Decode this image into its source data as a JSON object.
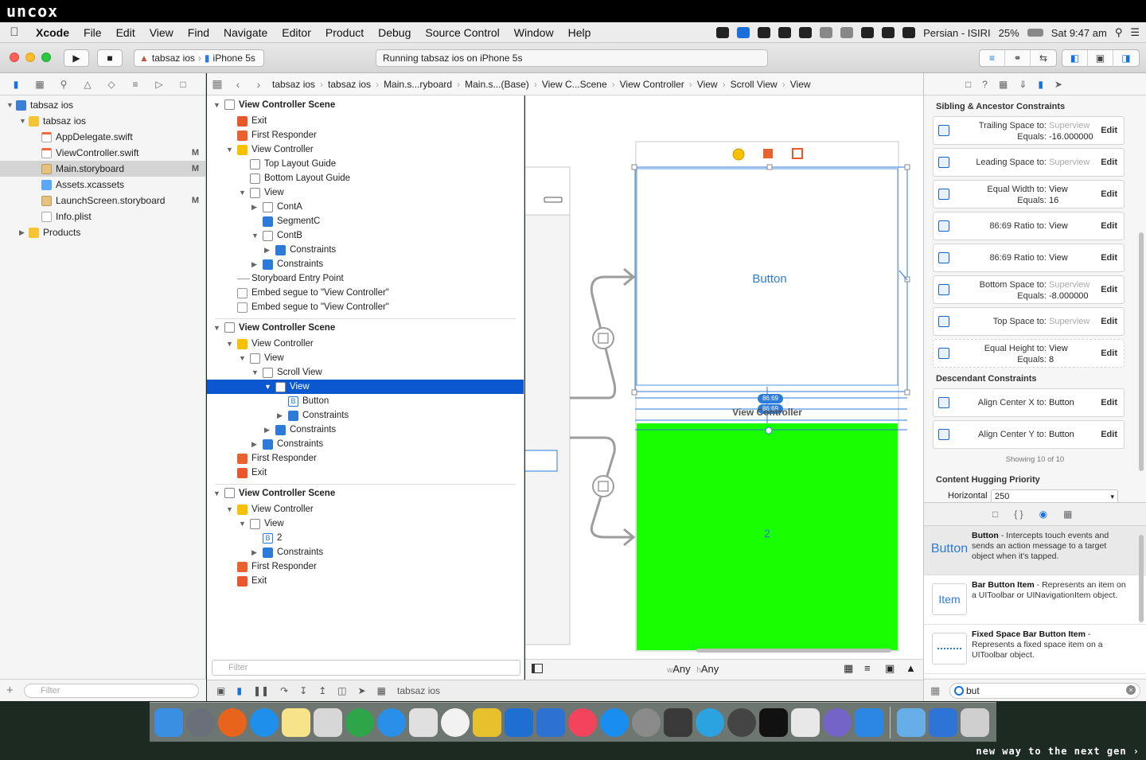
{
  "brand": {
    "logo": "uncox",
    "footer": "new way to the next gen ›"
  },
  "menubar": {
    "app": "Xcode",
    "items": [
      "File",
      "Edit",
      "View",
      "Find",
      "Navigate",
      "Editor",
      "Product",
      "Debug",
      "Source Control",
      "Window",
      "Help"
    ],
    "input_source": "Persian - ISIRI",
    "battery": "25%",
    "clock": "Sat 9:47 am"
  },
  "toolbar": {
    "scheme": "tabsaz ios",
    "device": "iPhone 5s",
    "status": "Running tabsaz ios on iPhone 5s"
  },
  "navigator": {
    "items": [
      {
        "label": "tabsaz ios",
        "level": 0,
        "icon": "project-icon",
        "disclosure": "▼",
        "badge": ""
      },
      {
        "label": "tabsaz ios",
        "level": 1,
        "icon": "folder-icon",
        "disclosure": "▼",
        "badge": ""
      },
      {
        "label": "AppDelegate.swift",
        "level": 2,
        "icon": "swift-file-icon",
        "disclosure": "",
        "badge": ""
      },
      {
        "label": "ViewController.swift",
        "level": 2,
        "icon": "swift-file-icon",
        "disclosure": "",
        "badge": "M"
      },
      {
        "label": "Main.storyboard",
        "level": 2,
        "icon": "storyboard-icon",
        "disclosure": "",
        "badge": "M",
        "selected": true
      },
      {
        "label": "Assets.xcassets",
        "level": 2,
        "icon": "assets-icon",
        "disclosure": "",
        "badge": ""
      },
      {
        "label": "LaunchScreen.storyboard",
        "level": 2,
        "icon": "storyboard-icon",
        "disclosure": "",
        "badge": "M"
      },
      {
        "label": "Info.plist",
        "level": 2,
        "icon": "plist-icon",
        "disclosure": "",
        "badge": ""
      },
      {
        "label": "Products",
        "level": 1,
        "icon": "folder-icon",
        "disclosure": "▶",
        "badge": ""
      }
    ],
    "filter_placeholder": "Filter"
  },
  "jumpbar": [
    "tabsaz ios",
    "tabsaz ios",
    "Main.s...ryboard",
    "Main.s...(Base)",
    "View C...Scene",
    "View Controller",
    "View",
    "Scroll View",
    "View"
  ],
  "outline": {
    "rows": [
      {
        "text": "View Controller Scene",
        "level": 0,
        "icon": "scene",
        "disc": "▼",
        "scene": true
      },
      {
        "text": "Exit",
        "level": 1,
        "icon": "exit",
        "disc": ""
      },
      {
        "text": "First Responder",
        "level": 1,
        "icon": "resp",
        "disc": ""
      },
      {
        "text": "View Controller",
        "level": 1,
        "icon": "vc",
        "disc": "▼"
      },
      {
        "text": "Top Layout Guide",
        "level": 2,
        "icon": "view",
        "disc": ""
      },
      {
        "text": "Bottom Layout Guide",
        "level": 2,
        "icon": "view",
        "disc": ""
      },
      {
        "text": "View",
        "level": 2,
        "icon": "view",
        "disc": "▼"
      },
      {
        "text": "ContA",
        "level": 3,
        "icon": "view",
        "disc": "▶"
      },
      {
        "text": "SegmentC",
        "level": 3,
        "icon": "blue",
        "disc": ""
      },
      {
        "text": "ContB",
        "level": 3,
        "icon": "view",
        "disc": "▼"
      },
      {
        "text": "Constraints",
        "level": 4,
        "icon": "blue",
        "disc": "▶"
      },
      {
        "text": "Constraints",
        "level": 3,
        "icon": "blue",
        "disc": "▶"
      },
      {
        "text": "Storyboard Entry Point",
        "level": 1,
        "icon": "entry",
        "disc": ""
      },
      {
        "text": "Embed segue to \"View Controller\"",
        "level": 1,
        "icon": "segue",
        "disc": ""
      },
      {
        "text": "Embed segue to \"View Controller\"",
        "level": 1,
        "icon": "segue",
        "disc": "",
        "divider": true
      },
      {
        "text": "View Controller Scene",
        "level": 0,
        "icon": "scene",
        "disc": "▼",
        "scene": true
      },
      {
        "text": "View Controller",
        "level": 1,
        "icon": "vc",
        "disc": "▼"
      },
      {
        "text": "View",
        "level": 2,
        "icon": "view",
        "disc": "▼"
      },
      {
        "text": "Scroll View",
        "level": 3,
        "icon": "view",
        "disc": "▼"
      },
      {
        "text": "View",
        "level": 4,
        "icon": "view",
        "disc": "▼",
        "selected": true
      },
      {
        "text": "Button",
        "level": 5,
        "icon": "b",
        "disc": ""
      },
      {
        "text": "Constraints",
        "level": 5,
        "icon": "blue",
        "disc": "▶"
      },
      {
        "text": "Constraints",
        "level": 4,
        "icon": "blue",
        "disc": "▶"
      },
      {
        "text": "Constraints",
        "level": 3,
        "icon": "blue",
        "disc": "▶"
      },
      {
        "text": "First Responder",
        "level": 1,
        "icon": "resp",
        "disc": ""
      },
      {
        "text": "Exit",
        "level": 1,
        "icon": "exit",
        "disc": "",
        "divider": true
      },
      {
        "text": "View Controller Scene",
        "level": 0,
        "icon": "scene",
        "disc": "▼",
        "scene": true
      },
      {
        "text": "View Controller",
        "level": 1,
        "icon": "vc",
        "disc": "▼"
      },
      {
        "text": "View",
        "level": 2,
        "icon": "view",
        "disc": "▼"
      },
      {
        "text": "2",
        "level": 3,
        "icon": "b",
        "disc": ""
      },
      {
        "text": "Constraints",
        "level": 3,
        "icon": "blue",
        "disc": "▶"
      },
      {
        "text": "First Responder",
        "level": 1,
        "icon": "resp",
        "disc": ""
      },
      {
        "text": "Exit",
        "level": 1,
        "icon": "exit",
        "disc": ""
      }
    ],
    "filter_placeholder": "Filter"
  },
  "canvas": {
    "button_label": "Button",
    "ratio_label_1": "86:69",
    "ratio_label_2": "86:69",
    "scene_title": "View Controller",
    "green_label": "2",
    "green_color": "#17ff00",
    "size_class_w": "Any",
    "size_class_h": "Any"
  },
  "debugbar": {
    "target": "tabsaz ios"
  },
  "inspector": {
    "sibling_title": "Sibling & Ancestor Constraints",
    "constraints": [
      {
        "l1": "Trailing Space to:",
        "v1": "Superview",
        "v1_gray": true,
        "l2": "Equals:",
        "v2": "-16.000000"
      },
      {
        "l1": "Leading Space to:",
        "v1": "Superview",
        "v1_gray": true,
        "l2": "",
        "v2": ""
      },
      {
        "l1": "Equal Width to:",
        "v1": "View",
        "v1_gray": false,
        "l2": "Equals:",
        "v2": "16"
      },
      {
        "l1": "86:69 Ratio to:",
        "v1": "View",
        "v1_gray": false,
        "l2": "",
        "v2": ""
      },
      {
        "l1": "86:69 Ratio to:",
        "v1": "View",
        "v1_gray": false,
        "l2": "",
        "v2": ""
      },
      {
        "l1": "Bottom Space to:",
        "v1": "Superview",
        "v1_gray": true,
        "l2": "Equals:",
        "v2": "-8.000000"
      },
      {
        "l1": "Top Space to:",
        "v1": "Superview",
        "v1_gray": true,
        "l2": "",
        "v2": ""
      },
      {
        "l1": "Equal Height to:",
        "v1": "View",
        "v1_gray": false,
        "l2": "Equals:",
        "v2": "8",
        "dashed": true
      }
    ],
    "descendant_title": "Descendant Constraints",
    "descendants": [
      {
        "l1": "Align Center X to:",
        "v1": "Button"
      },
      {
        "l1": "Align Center Y to:",
        "v1": "Button"
      }
    ],
    "edit_label": "Edit",
    "showing": "Showing 10 of 10",
    "hugging_title": "Content Hugging Priority",
    "hugging_label": "Horizontal",
    "hugging_value": "250"
  },
  "library": {
    "items": [
      {
        "icon_text": "Button",
        "name": "Button",
        "desc": " - Intercepts touch events and sends an action message to a target object when it's tapped."
      },
      {
        "icon_text": "Item",
        "name": "Bar Button Item",
        "desc": " - Represents an item on a UIToolbar or UINavigationItem object."
      },
      {
        "icon_text": "",
        "name": "Fixed Space Bar Button Item",
        "desc": " - Represents a fixed space item on a UIToolbar object."
      }
    ],
    "search_value": "but"
  }
}
